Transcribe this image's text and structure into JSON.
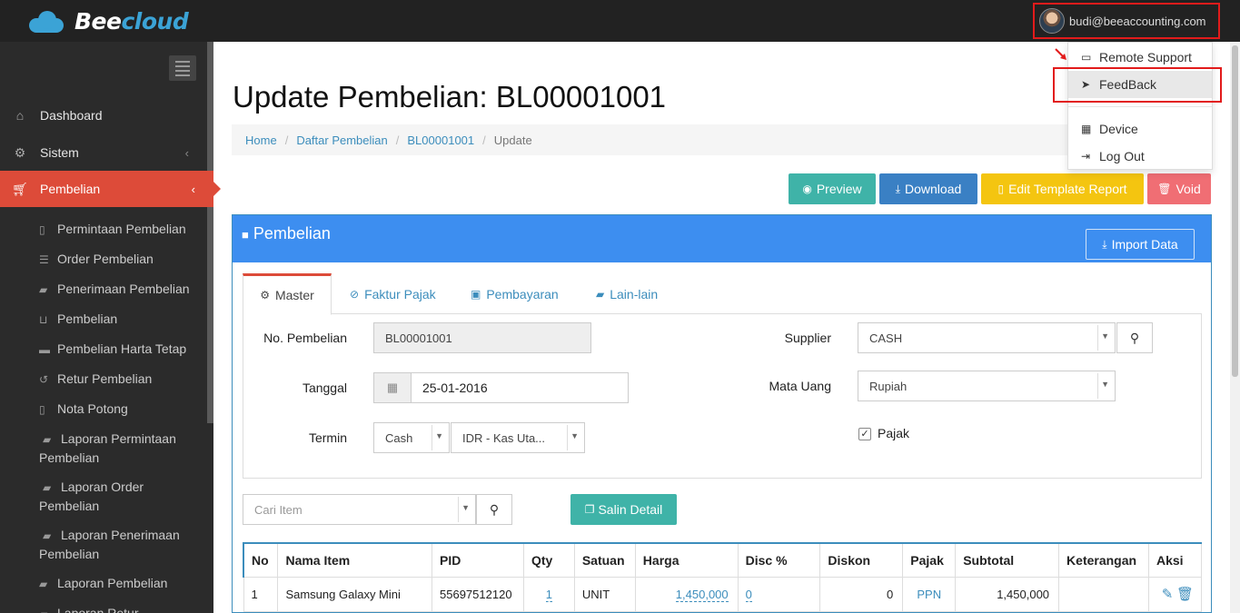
{
  "app": {
    "brand_part1": "Bee",
    "brand_part2": "cloud"
  },
  "user": {
    "email": "budi@beeaccounting.com"
  },
  "user_menu": {
    "items": [
      {
        "label": "Remote Support",
        "icon": "monitor-icon"
      },
      {
        "label": "FeedBack",
        "icon": "paper-plane-icon"
      },
      {
        "label": "Device",
        "icon": "qrcode-icon"
      },
      {
        "label": "Log Out",
        "icon": "sign-out-icon"
      }
    ]
  },
  "sidebar": {
    "menu": [
      {
        "label": "Dashboard",
        "icon": "home-icon"
      },
      {
        "label": "Sistem",
        "icon": "cogs-icon"
      },
      {
        "label": "Pembelian",
        "icon": "cart-icon"
      }
    ],
    "submenu": [
      {
        "label": "Permintaan Pembelian",
        "icon": "file-icon"
      },
      {
        "label": "Order Pembelian",
        "icon": "list-icon"
      },
      {
        "label": "Penerimaan Pembelian",
        "icon": "book-icon"
      },
      {
        "label": "Pembelian",
        "icon": "cart-icon"
      },
      {
        "label": "Pembelian Harta Tetap",
        "icon": "car-icon"
      },
      {
        "label": "Retur Pembelian",
        "icon": "undo-icon"
      },
      {
        "label": "Nota Potong",
        "icon": "file-icon"
      },
      {
        "label": "Laporan Permintaan Pembelian",
        "icon": "book-icon"
      },
      {
        "label": "Laporan Order Pembelian",
        "icon": "book-icon"
      },
      {
        "label": "Laporan Penerimaan Pembelian",
        "icon": "book-icon"
      },
      {
        "label": "Laporan Pembelian",
        "icon": "book-icon"
      },
      {
        "label": "Laporan Retur",
        "icon": "book-icon"
      }
    ]
  },
  "page": {
    "title": "Update Pembelian: BL00001001",
    "breadcrumb": [
      "Home",
      "Daftar Pembelian",
      "BL00001001",
      "Update"
    ]
  },
  "actions": {
    "preview": "Preview",
    "download": "Download",
    "template": "Edit Template Report",
    "void": "Void"
  },
  "panel": {
    "title": "Pembelian",
    "import": "Import Data",
    "tabs": [
      "Master",
      "Faktur Pajak",
      "Pembayaran",
      "Lain-lain"
    ]
  },
  "form": {
    "no_label": "No. Pembelian",
    "no_value": "BL00001001",
    "tanggal_label": "Tanggal",
    "tanggal_value": "25-01-2016",
    "termin_label": "Termin",
    "termin_value": "Cash",
    "kas_value": "IDR - Kas Uta...",
    "supplier_label": "Supplier",
    "supplier_value": "CASH",
    "mata_uang_label": "Mata Uang",
    "mata_uang_value": "Rupiah",
    "pajak_label": "Pajak",
    "pajak_checked": true
  },
  "items_toolbar": {
    "search_placeholder": "Cari Item",
    "salin": "Salin Detail"
  },
  "table": {
    "headers": [
      "No",
      "Nama Item",
      "PID",
      "Qty",
      "Satuan",
      "Harga",
      "Disc %",
      "Diskon",
      "Pajak",
      "Subtotal",
      "Keterangan",
      "Aksi"
    ],
    "rows": [
      {
        "no": "1",
        "nama": "Samsung Galaxy Mini",
        "pid": "55697512120",
        "qty": "1",
        "satuan": "UNIT",
        "harga": "1,450,000",
        "disc": "0",
        "diskon": "0",
        "pajak": "PPN",
        "subtotal": "1,450,000",
        "keterangan": ""
      }
    ]
  }
}
